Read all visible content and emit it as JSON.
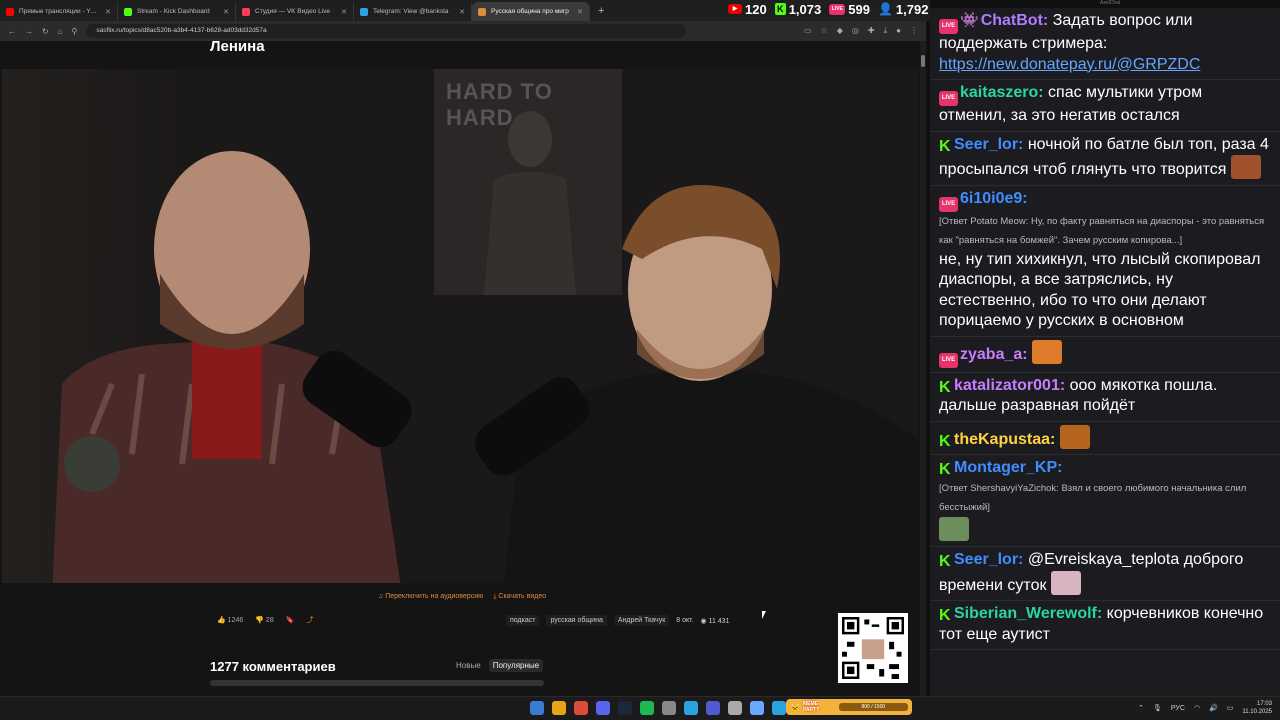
{
  "browser": {
    "tabs": [
      {
        "label": "Прямые трансляции - YouTube",
        "color": "#ff0000"
      },
      {
        "label": "Stream - Kick Dashboard",
        "color": "#53fc18"
      },
      {
        "label": "Студия — VK Видео Live",
        "color": "#ff3b5c"
      },
      {
        "label": "Telegram: View @banksta",
        "color": "#2aa3e0"
      },
      {
        "label": "Русская община про мигр",
        "color": "#e08a3c",
        "active": true
      }
    ],
    "new_tab": "+",
    "url": "sasflix.ru/topics/d8ac520b-a3b4-4137-b628-ad03dd32d57a"
  },
  "stream_stats": {
    "youtube": "120",
    "kick": "1,073",
    "vk": "599",
    "total": "1,792"
  },
  "page": {
    "heading": "Ленина",
    "poster_text": "HARD TO HARD",
    "switch_audio": "Переключить на аудиоверсию",
    "download": "Скачать видео",
    "likes": "1246",
    "dislikes": "28",
    "tags": [
      "подкаст",
      "русская община",
      "Андрей Ткачук"
    ],
    "date": "8 окт.",
    "views": "11 431",
    "comments_title": "1277 комментариев",
    "sort_new": "Новые",
    "sort_popular": "Популярные"
  },
  "chat": {
    "window_title": "AxelChat",
    "messages": [
      {
        "platform": "vk",
        "bot": true,
        "name": "ChatBot:",
        "color": "#b07bff",
        "text": "Задать вопрос или поддержать стримера:",
        "link": "https://new.donatepay.ru/@GRPZDC"
      },
      {
        "platform": "vk",
        "name": "kaitaszero:",
        "color": "#2bd4a4",
        "text": "спас мультики утром отменил, за это негатив остался"
      },
      {
        "platform": "kick",
        "name": "Seer_lor:",
        "color": "#3f8dff",
        "text": "ночной по батле был топ, раза 4 просыпался чтоб глянуть что творится",
        "emote": "#a0522d"
      },
      {
        "platform": "vk",
        "name": "6i10i0e9:",
        "color": "#3f8dff",
        "reply": "[Ответ Potato Meow: Ну, по факту равняться на диаспоры - это равняться как \"равняться на бомжей\". Зачем русским копирова...]",
        "text": "не, ну тип хихикнул, что лысый скопировал диаспоры, а все затряслись, ну естественно, ибо то что они делают порицаемо у русских в основном"
      },
      {
        "platform": "vk",
        "name": "zyaba_a:",
        "color": "#c77dff",
        "text": "",
        "emote": "#e07a2b"
      },
      {
        "platform": "kick",
        "name": "katalizator001:",
        "color": "#c77dff",
        "text": "ооо мякотка пошла. дальше разравная пойдёт"
      },
      {
        "platform": "kick",
        "name": "theKapustaa:",
        "color": "#ffd23f",
        "text": "",
        "emote": "#b5651d"
      },
      {
        "platform": "kick",
        "name": "Montager_KP:",
        "color": "#3f8dff",
        "reply": "[Ответ ShershavyiYaZichok: Взял и своего любимого начальника слил бесстыжий]",
        "text": "",
        "emote": "#6b8e5a"
      },
      {
        "platform": "kick",
        "name": "Seer_lor:",
        "color": "#3f8dff",
        "text": "@Evreiskaya_teplota доброго времени суток",
        "emote": "#d8b4c0"
      },
      {
        "platform": "kick",
        "name": "Siberian_Werewolf:",
        "color": "#2bd4a4",
        "text": "корчевников конечно тот еще аутист"
      }
    ]
  },
  "taskbar": {
    "party_label": "MEME PARTY",
    "party_progress_text": "800 / 1500",
    "party_progress": 0.53,
    "lang": "РУС",
    "time": "17:03",
    "date": "11.10.2025",
    "apps": [
      "#3a7bd5",
      "#e8a317",
      "#dd4b39",
      "#5865f2",
      "#1b2838",
      "#1db954",
      "#888888",
      "#2aa3e0",
      "#4f5bd5",
      "#aaaaaa",
      "#6aa8ff",
      "#2aa3e0"
    ]
  }
}
